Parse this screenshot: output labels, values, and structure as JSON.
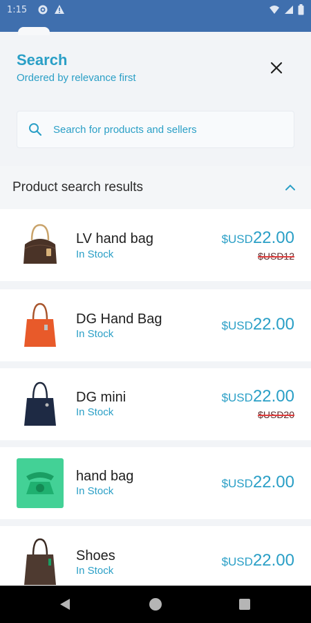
{
  "status_bar": {
    "time": "1:15",
    "left_icons": [
      "settings-icon",
      "alert-icon"
    ],
    "right_icons": [
      "wifi-icon",
      "signal-icon",
      "battery-icon"
    ]
  },
  "search_panel": {
    "title": "Search",
    "subtitle": "Ordered by relevance first",
    "close_icon": "close-icon",
    "input": {
      "value": "",
      "placeholder": "Search for products and sellers"
    }
  },
  "results": {
    "section_title": "Product search results",
    "items": [
      {
        "name": "LV hand bag",
        "stock": "In Stock",
        "currency": "$USD",
        "price": "22.00",
        "old_price": "$USD12",
        "thumb": "brown-handbag"
      },
      {
        "name": "DG Hand Bag",
        "stock": "In Stock",
        "currency": "$USD",
        "price": "22.00",
        "old_price": "",
        "thumb": "orange-tote"
      },
      {
        "name": "DG mini",
        "stock": "In Stock",
        "currency": "$USD",
        "price": "22.00",
        "old_price": "$USD20",
        "thumb": "navy-tote"
      },
      {
        "name": "hand bag",
        "stock": "In Stock",
        "currency": "$USD",
        "price": "22.00",
        "old_price": "",
        "thumb": "green-telephone"
      },
      {
        "name": "Shoes",
        "stock": "In Stock",
        "currency": "$USD",
        "price": "22.00",
        "old_price": "",
        "thumb": "brown-tote"
      }
    ]
  },
  "colors": {
    "accent": "#2a9fc6",
    "status_bar": "#3f6fae",
    "strike": "#e03b3b"
  }
}
